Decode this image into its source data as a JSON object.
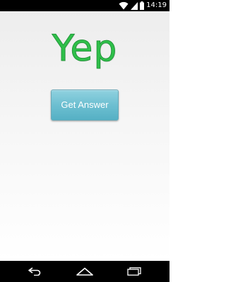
{
  "status_bar": {
    "time": "14:19",
    "icons": [
      "wifi-icon",
      "cell-signal-icon",
      "battery-icon"
    ]
  },
  "main": {
    "answer": "Yep",
    "answer_color": "#2fbf4a",
    "button_label": "Get Answer",
    "button_color": "#6dbfd1"
  },
  "nav_bar": {
    "icons": [
      "back-icon",
      "home-icon",
      "recent-apps-icon"
    ]
  }
}
